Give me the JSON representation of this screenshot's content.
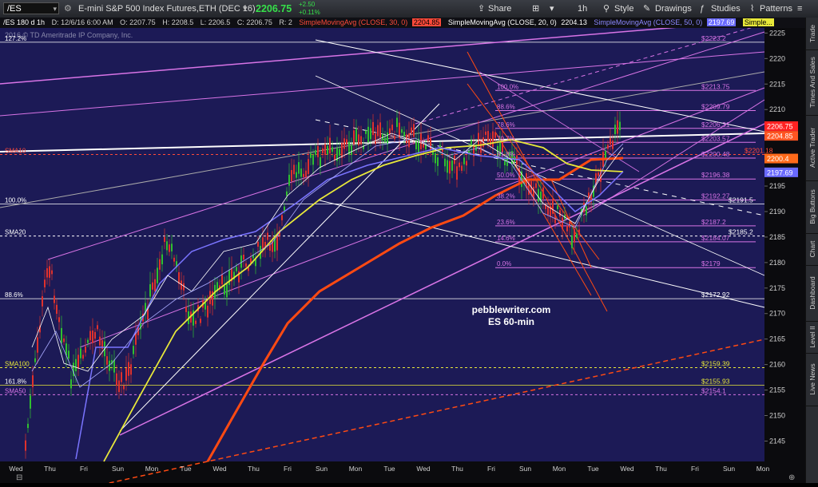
{
  "toolbar": {
    "symbol": "/ES",
    "description": "E-mini S&P 500 Index Futures,ETH (DEC 16)",
    "last_price": "2206.75",
    "net_change": "+2.50",
    "pct_change": "+0.11%",
    "share": "Share",
    "timeframe": "1h",
    "style": "Style",
    "drawings": "Drawings",
    "studies": "Studies",
    "patterns": "Patterns"
  },
  "statusbar": {
    "chart_label": "/ES 180 d 1h",
    "d": "D: 12/6/16 6:00 AM",
    "o": "O: 2207.75",
    "h": "H: 2208.5",
    "l": "L: 2206.5",
    "c": "C: 2206.75",
    "r": "R: 2",
    "sma30_label": "SimpleMovingAvg (CLOSE, 30, 0)",
    "sma30_value": "2204.85",
    "sma20_label": "SimpleMovingAvg (CLOSE, 20, 0)",
    "sma20_value": "2204.13",
    "sma50_label": "SimpleMovingAvg (CLOSE, 50, 0)",
    "sma50_value": "2197.69",
    "extra": "Simple...",
    "copyright": "2016 © TD Ameritrade IP Company, Inc."
  },
  "sidetabs": [
    "Trade",
    "Times And Sales",
    "Active Trader",
    "Big Buttons",
    "Chart",
    "Dashboard",
    "Level II",
    "Live News"
  ],
  "colors": {
    "chart_bg": "#1c1a56",
    "magenta": "#d874e6",
    "orange": "#ff4a12",
    "yellow": "#e8e83a",
    "blue": "#7a74ff",
    "white": "#ffffff",
    "up_candle": "#2fbf2f",
    "down_candle": "#e0312c"
  },
  "chart_data": {
    "type": "line",
    "title": "pebblewriter.com",
    "subtitle": "ES 60-min",
    "ylim": [
      2141,
      2226
    ],
    "yticks": [
      2145,
      2150,
      2155,
      2160,
      2165,
      2170,
      2175,
      2180,
      2185,
      2190,
      2195,
      2200,
      2205,
      2210,
      2215,
      2220,
      2225
    ],
    "xticks": [
      "Wed",
      "Thu",
      "Fri",
      "Sun",
      "Mon",
      "Tue",
      "Wed",
      "Thu",
      "Fri",
      "Sun",
      "Mon",
      "Tue",
      "Wed",
      "Thu",
      "Fri",
      "Sun",
      "Mon",
      "Tue",
      "Wed",
      "Thu",
      "Fri",
      "Sun",
      "Mon"
    ],
    "price_badges": [
      {
        "value": "2206.75",
        "color": "#ff2222"
      },
      {
        "value": "2204.85",
        "color": "#ff5522"
      },
      {
        "value": "2200.4",
        "color": "#ff6a1a"
      },
      {
        "value": "2197.69",
        "color": "#6a6aff"
      }
    ],
    "fib_left": [
      {
        "label": "127.2%",
        "price": 2223.2
      },
      {
        "label": "100.0%",
        "price": 2191.5
      },
      {
        "label": "88.6%",
        "price": 2172.92
      },
      {
        "label": "161.8%",
        "price": 2155.93
      }
    ],
    "fib_right": [
      {
        "label": "100.0%",
        "price": 2213.75
      },
      {
        "label": "88.6%",
        "price": 2209.79
      },
      {
        "label": "78.6%",
        "price": 2206.31
      },
      {
        "label": "70.7%",
        "price": 2203.57
      },
      {
        "label": "61.8%",
        "price": 2200.48
      },
      {
        "label": "50.0%",
        "price": 2196.38
      },
      {
        "label": "38.2%",
        "price": 2192.27
      },
      {
        "label": "23.6%",
        "price": 2187.2
      },
      {
        "label": "14.6%",
        "price": 2184.07
      },
      {
        "label": "0.0%",
        "price": 2179
      }
    ],
    "right_value_labels": [
      {
        "text": "$2223.2",
        "price": 2223.2
      },
      {
        "text": "$2213.75",
        "price": 2213.75
      },
      {
        "text": "$2209.79",
        "price": 2209.79
      },
      {
        "text": "$2206.31",
        "price": 2206.31
      },
      {
        "text": "$2203.57",
        "price": 2203.57
      },
      {
        "text": "$2200.48",
        "price": 2200.48
      },
      {
        "text": "$2201.18",
        "price": 2201.18
      },
      {
        "text": "$2196.38",
        "price": 2196.38
      },
      {
        "text": "$2192.27",
        "price": 2192.27
      },
      {
        "text": "$2191.5",
        "price": 2191.5
      },
      {
        "text": "$2187.2",
        "price": 2187.2
      },
      {
        "text": "$2185.2",
        "price": 2185.2
      },
      {
        "text": "$2184.07",
        "price": 2184.07
      },
      {
        "text": "$2179",
        "price": 2179
      },
      {
        "text": "$2172.92",
        "price": 2172.92
      },
      {
        "text": "$2159.39",
        "price": 2159.39
      },
      {
        "text": "$2155.93",
        "price": 2155.93
      },
      {
        "text": "$2154.1",
        "price": 2154.1
      }
    ],
    "sma_labels": [
      {
        "label": "SMA10",
        "price": 2201.18
      },
      {
        "label": "SMA20",
        "price": 2185.2
      },
      {
        "label": "SMA100",
        "price": 2159.39
      },
      {
        "label": "SMA50",
        "price": 2154.1
      }
    ]
  }
}
